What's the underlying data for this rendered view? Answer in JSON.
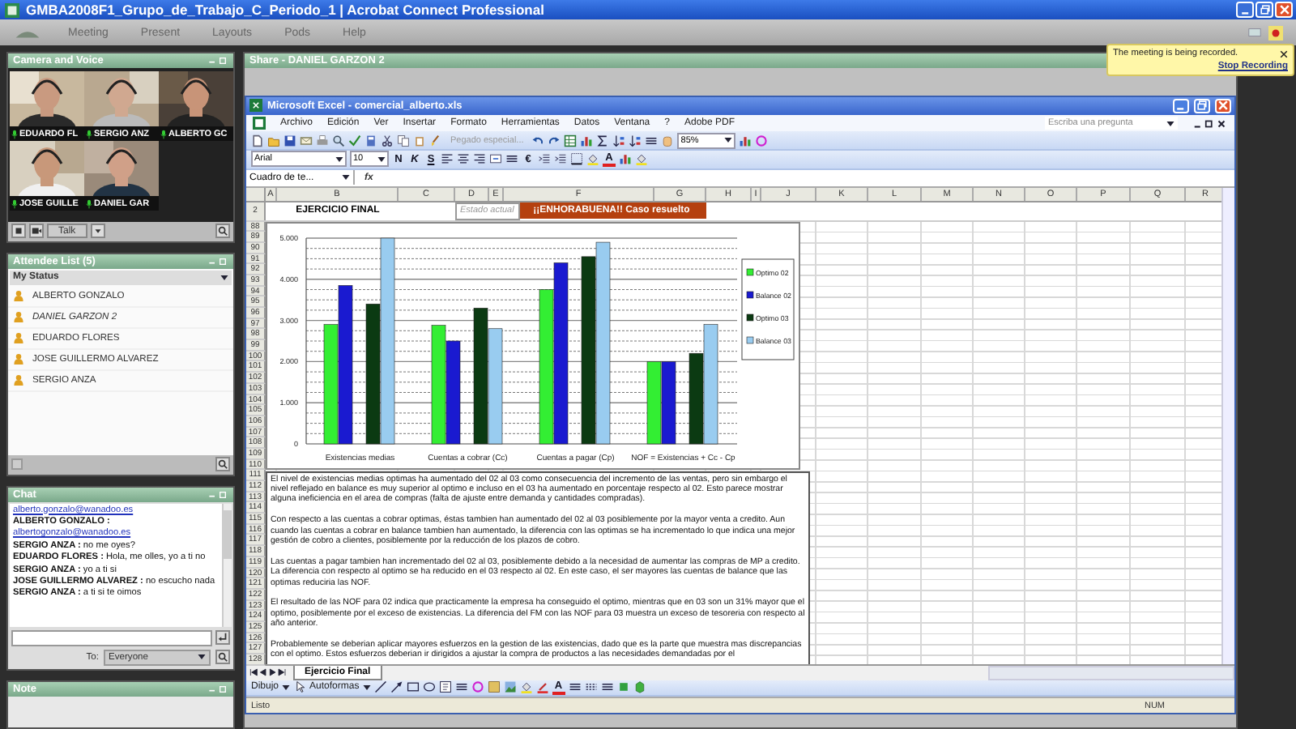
{
  "window": {
    "title": "GMBA2008F1_Grupo_de_Trabajo_C_Periodo_1 | Acrobat Connect Professional"
  },
  "menu": [
    "Meeting",
    "Present",
    "Layouts",
    "Pods",
    "Help"
  ],
  "recording_notice": {
    "message": "The meeting is being recorded.",
    "action": "Stop Recording"
  },
  "camera_pod": {
    "title": "Camera and Voice",
    "talk_button": "Talk",
    "videos": [
      {
        "name": "EDUARDO FL"
      },
      {
        "name": "SERGIO ANZ"
      },
      {
        "name": "ALBERTO GC"
      },
      {
        "name": "JOSE GUILLE"
      },
      {
        "name": "DANIEL GAR"
      }
    ]
  },
  "attendee_pod": {
    "title": "Attendee List (5)",
    "status": "My Status",
    "attendees": [
      {
        "name": "ALBERTO GONZALO",
        "self": false
      },
      {
        "name": "DANIEL GARZON  2",
        "self": true
      },
      {
        "name": "EDUARDO FLORES",
        "self": false
      },
      {
        "name": "JOSE GUILLERMO ALVAREZ",
        "self": false
      },
      {
        "name": "SERGIO ANZA",
        "self": false
      }
    ]
  },
  "chat_pod": {
    "title": "Chat",
    "to_label": "To:",
    "recipient": "Everyone",
    "messages": [
      {
        "link": "alberto.gonzalo@wanadoo.es"
      },
      {
        "sender": "ALBERTO GONZALO :",
        "link": "albertogonzalo@wanadoo.es"
      },
      {
        "sender": "SERGIO ANZA :",
        "text": "no me oyes?"
      },
      {
        "sender": "EDUARDO FLORES :",
        "text": "Hola, me olles, yo a ti no"
      },
      {
        "sender": "SERGIO ANZA :",
        "text": "yo a  ti si"
      },
      {
        "sender": "JOSE GUILLERMO ALVAREZ :",
        "text": "no escucho nada"
      },
      {
        "sender": "SERGIO ANZA :",
        "text": "a ti si te oimos"
      }
    ]
  },
  "note_pod": {
    "title": "Note"
  },
  "share_pod": {
    "title": "Share - DANIEL GARZON  2"
  },
  "excel": {
    "title": "Microsoft Excel - comercial_alberto.xls",
    "menu": [
      "Archivo",
      "Edición",
      "Ver",
      "Insertar",
      "Formato",
      "Herramientas",
      "Datos",
      "Ventana",
      "?",
      "Adobe PDF"
    ],
    "help_placeholder": "Escriba una pregunta",
    "paste_special": "Pegado especial...",
    "zoom": "85%",
    "font": "Arial",
    "font_size": "10",
    "format_buttons": [
      "N",
      "K",
      "S"
    ],
    "currency_button": "€",
    "font_color_button": "A",
    "draw_font_color_button": "A",
    "name_box": "Cuadro de te...",
    "formula_label": "fx",
    "columns": [
      "A",
      "B",
      "C",
      "D",
      "E",
      "F",
      "G",
      "H",
      "I",
      "J",
      "K",
      "L",
      "M",
      "N",
      "O",
      "P",
      "Q",
      "R"
    ],
    "title_row_number": "2",
    "title_cell": "EJERCICIO FINAL",
    "status_label": "Estado actual",
    "status_value": "¡¡ENHORABUENA!! Caso resuelto",
    "row_numbers": [
      "88",
      "89",
      "90",
      "91",
      "92",
      "93",
      "94",
      "95",
      "96",
      "97",
      "98",
      "99",
      "100",
      "101",
      "102",
      "103",
      "104",
      "105",
      "106",
      "107",
      "108",
      "109",
      "110",
      "111",
      "112",
      "113",
      "114",
      "115",
      "116",
      "117",
      "118",
      "119",
      "120",
      "121",
      "122",
      "123",
      "124",
      "125",
      "126",
      "127",
      "128"
    ],
    "chart_data": {
      "type": "bar",
      "categories": [
        "Existencias medias",
        "Cuentas a cobrar (Cc)",
        "Cuentas a pagar (Cp)",
        "NOF = Existencias + Cc - Cp"
      ],
      "series": [
        {
          "name": "Optimo 02",
          "color": "#33ee33",
          "values": [
            2900,
            2880,
            3750,
            2000
          ]
        },
        {
          "name": "Balance 02",
          "color": "#1a1ad0",
          "values": [
            3850,
            2500,
            4400,
            2000
          ]
        },
        {
          "name": "Optimo 03",
          "color": "#0b3a12",
          "values": [
            3400,
            3300,
            4550,
            2200
          ]
        },
        {
          "name": "Balance 03",
          "color": "#99ccf0",
          "values": [
            5000,
            2800,
            4900,
            2900
          ]
        }
      ],
      "ylim": [
        0,
        5000
      ],
      "grid": true,
      "legend": "right",
      "yticks": [
        {
          "value": 0,
          "label": "0"
        },
        {
          "value": 1000,
          "label": "1.000"
        },
        {
          "value": 2000,
          "label": "2.000"
        },
        {
          "value": 3000,
          "label": "3.000"
        },
        {
          "value": 4000,
          "label": "4.000"
        },
        {
          "value": 5000,
          "label": "5.000"
        }
      ]
    },
    "paragraphs": [
      "El nivel de existencias medias optimas ha aumentado del 02 al 03 como consecuencia del incremento de las ventas, pero sin embargo el nivel reflejado en balance es muy superior al optimo e incluso en el 03 ha aumentado en porcentaje respecto al 02. Esto parece mostrar alguna ineficiencia en el area de compras (falta de ajuste entre demanda y cantidades compradas).",
      "Con respecto a las cuentas a cobrar optimas, éstas tambien han aumentado del 02 al 03 posiblemente por la mayor venta a credito.  Aun cuando las cuentas a cobrar en balance tambien han aumentado, la diferencia con las optimas se ha incrementado lo que indica una mejor gestión de cobro a clientes, posiblemente por la reducción de los plazos de cobro.",
      "Las cuentas a pagar tambien han incrementado del 02 al 03, posiblemente debido a la necesidad de aumentar las compras de MP a credito. La diferencia con respecto al optimo se ha reducido en el 03 respecto al 02.  En este caso, el ser mayores las cuentas de balance que las optimas reduciria las NOF.",
      "El resultado de las NOF para 02 indica que practicamente la empresa ha conseguido el optimo, mientras que en 03 son un 31% mayor que el optimo, posiblemente por el exceso de existencias.  La diferencia del FM con las NOF para 03 muestra un exceso de tesoreria con respecto al año anterior.",
      "Probablemente se deberian aplicar mayores esfuerzos en la gestion de las existencias, dado que es la parte que muestra mas discrepancias con el optimo.  Estos esfuerzos deberian ir dirigidos a ajustar la compra de productos a las necesidades demandadas por el"
    ],
    "sheet_tab": "Ejercicio Final",
    "draw_menu": "Dibujo",
    "autoshapes": "Autoformas",
    "status": "Listo",
    "num_indicator": "NUM"
  }
}
